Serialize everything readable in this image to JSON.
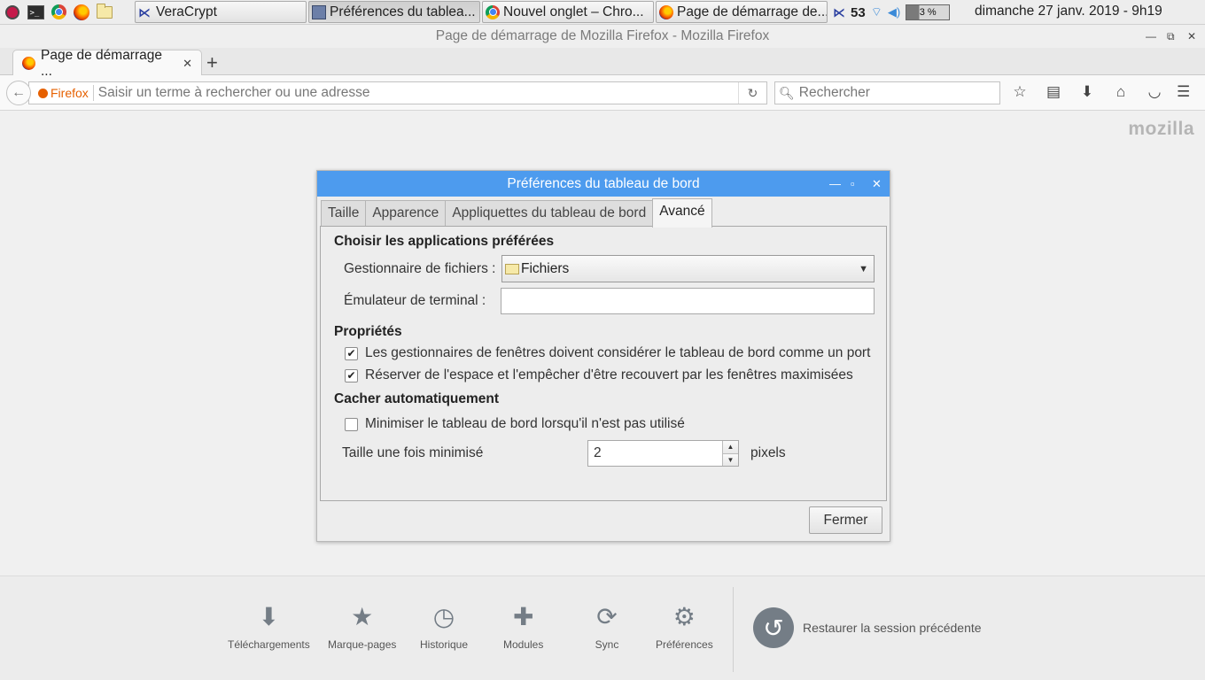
{
  "taskbar": {
    "tasks": [
      {
        "label": "VeraCrypt"
      },
      {
        "label": "Préférences du tablea..."
      },
      {
        "label": "Nouvel onglet – Chro..."
      },
      {
        "label": "Page de démarrage de..."
      }
    ],
    "tray_count": "53",
    "cpu_label": "3 %",
    "clock": "dimanche 27 janv. 2019 -  9h19"
  },
  "firefox": {
    "window_title": "Page de démarrage de Mozilla Firefox - Mozilla Firefox",
    "tab_label": "Page de démarrage ...",
    "identity_label": "Firefox",
    "url_placeholder": "Saisir un terme à rechercher ou une adresse",
    "search_placeholder": "Rechercher",
    "brand": "mozilla"
  },
  "launcher": {
    "items": [
      {
        "label": "Téléchargements",
        "icon": "download-icon"
      },
      {
        "label": "Marque-pages",
        "icon": "star-icon"
      },
      {
        "label": "Historique",
        "icon": "clock-icon"
      },
      {
        "label": "Modules",
        "icon": "puzzle-icon"
      },
      {
        "label": "Sync",
        "icon": "sync-icon"
      },
      {
        "label": "Préférences",
        "icon": "gear-icon"
      }
    ],
    "restore_label": "Restaurer la session précédente"
  },
  "dialog": {
    "title": "Préférences du tableau de bord",
    "tabs": [
      {
        "label": "Taille"
      },
      {
        "label": "Apparence"
      },
      {
        "label": "Appliquettes du tableau de bord"
      },
      {
        "label": "Avancé"
      }
    ],
    "active_tab": "Avancé",
    "section_apps": "Choisir les applications préférées",
    "file_manager_label": "Gestionnaire de fichiers :",
    "file_manager_value": "Fichiers",
    "terminal_label": "Émulateur de terminal :",
    "terminal_value": "",
    "section_props": "Propriétés",
    "check_dock_label": "Les gestionnaires de fenêtres doivent considérer le tableau de bord comme un port",
    "check_dock": true,
    "check_reserve_label": "Réserver de l'espace et l'empêcher d'être recouvert par les fenêtres maximisées",
    "check_reserve": true,
    "section_autohide": "Cacher automatiquement",
    "check_minimize_label": "Minimiser le tableau de bord lorsqu'il n'est pas utilisé",
    "check_minimize": false,
    "min_size_label": "Taille une fois minimisé",
    "min_size_value": "2",
    "min_size_unit": "pixels",
    "close_label": "Fermer"
  },
  "colors": {
    "dialog_titlebar": "#4d9bee",
    "firefox_accent": "#e66000"
  }
}
